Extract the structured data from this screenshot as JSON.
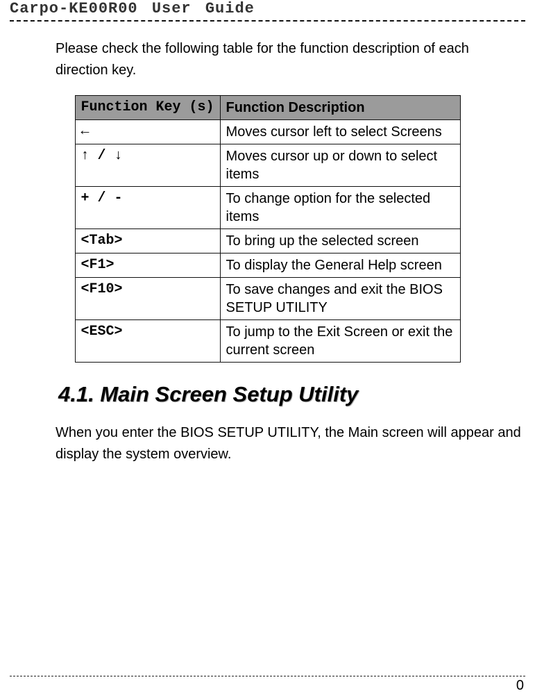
{
  "header": {
    "title": "Carpo-KE00R00 User Guide"
  },
  "intro_text": "Please check the following table for the function description of each direction key.",
  "table": {
    "headers": {
      "key": "Function Key (s)",
      "desc": "Function Description"
    },
    "rows": [
      {
        "key": "←",
        "desc": "Moves cursor left to select Screens"
      },
      {
        "key": "↑ / ↓",
        "desc": "Moves cursor up or down to select items"
      },
      {
        "key": "+ / -",
        "desc": "To change option for the selected items"
      },
      {
        "key": "<Tab>",
        "desc": "To bring up the selected screen"
      },
      {
        "key": "<F1>",
        "desc": "To display the General Help screen"
      },
      {
        "key": "<F10>",
        "desc": "To save changes and exit the BIOS SETUP UTILITY"
      },
      {
        "key": "<ESC>",
        "desc": "To jump to the Exit Screen or exit the current screen"
      }
    ]
  },
  "section_heading": "4.1. Main Screen Setup Utility",
  "section_body": "When you enter the BIOS SETUP UTILITY, the Main screen will appear and display the system overview.",
  "page_number": "0"
}
